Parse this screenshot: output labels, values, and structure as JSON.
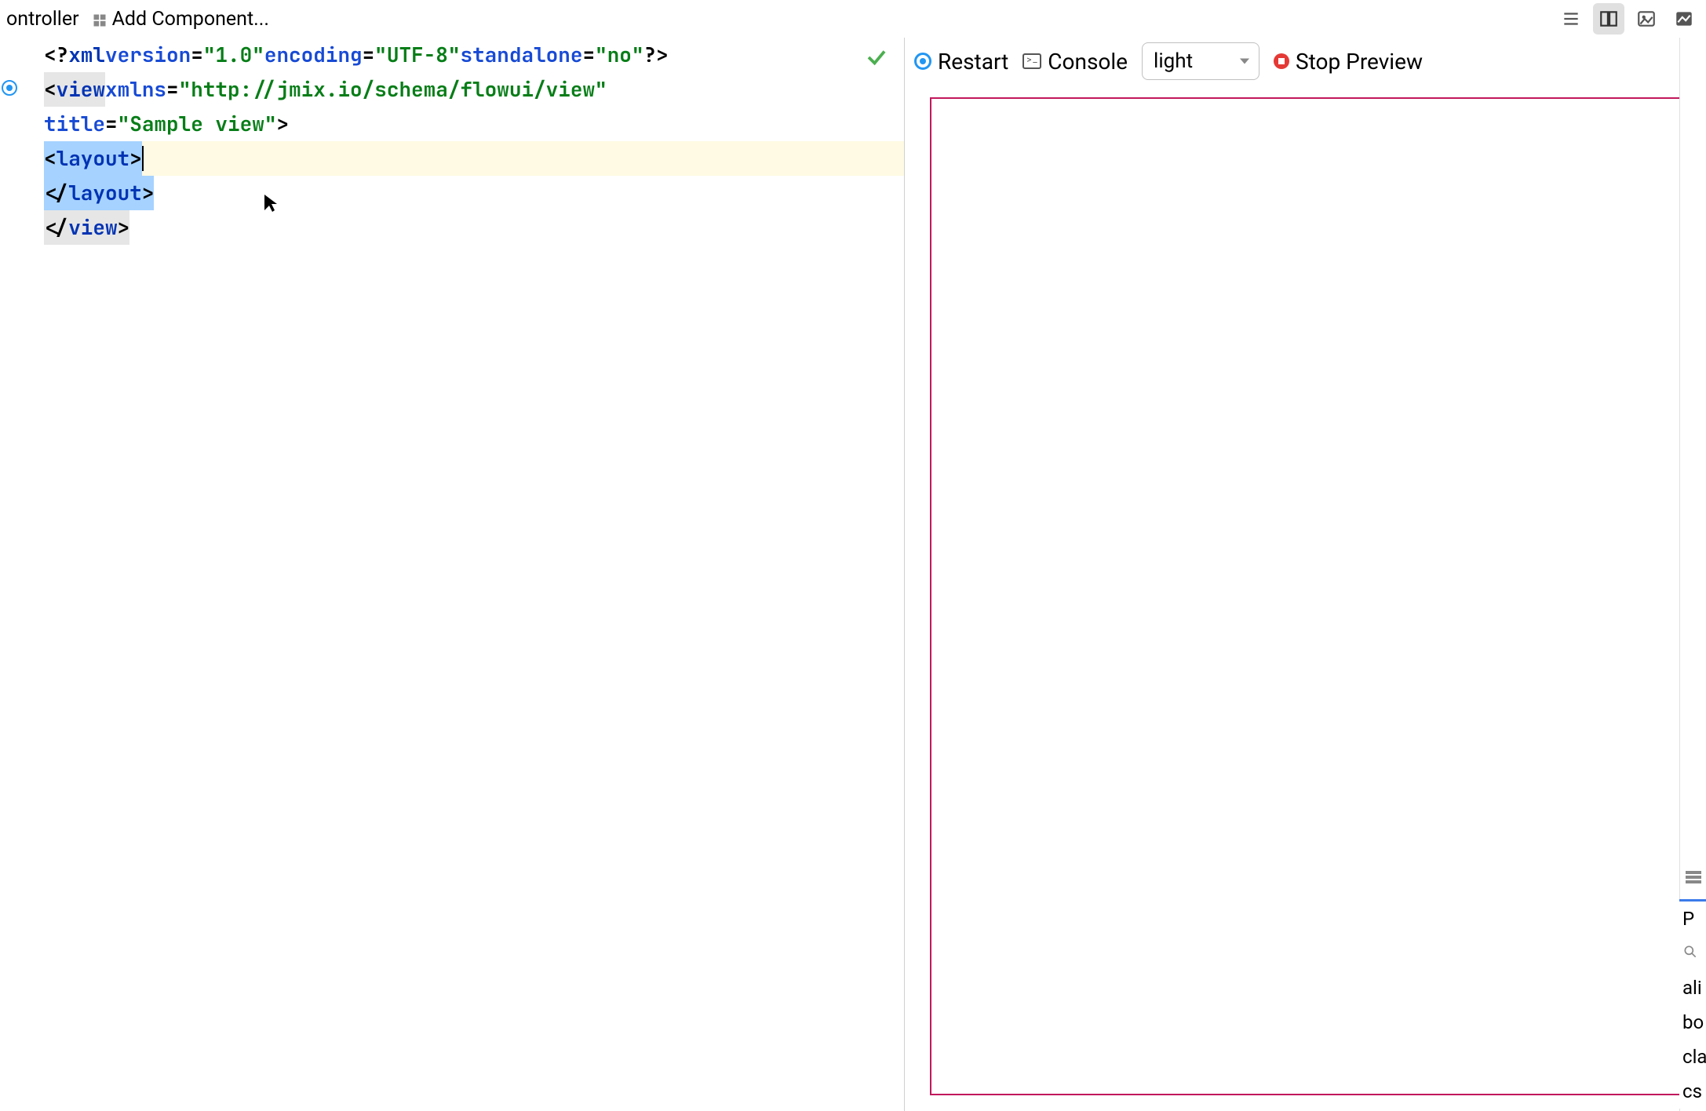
{
  "toolbar": {
    "controller_label": "ontroller",
    "add_component_label": "Add Component..."
  },
  "code": {
    "line1": {
      "xml_open": "<?",
      "xml": "xml",
      "version_attr": "version",
      "version_val": "\"1.0\"",
      "encoding_attr": "encoding",
      "encoding_val": "\"UTF-8\"",
      "standalone_attr": "standalone",
      "standalone_val": "\"no\"",
      "xml_close": "?>"
    },
    "line2": {
      "open": "<",
      "tag": "view",
      "xmlns_attr": "xmlns",
      "xmlns_val": "\"http://jmix.io/schema/flowui/view\""
    },
    "line3": {
      "title_attr": "title",
      "title_val": "\"Sample view\"",
      "close": ">"
    },
    "line4": {
      "open": "<",
      "tag": "layout",
      "close": ">"
    },
    "line5": {
      "open": "</",
      "tag": "layout",
      "close": ">"
    },
    "line6": {
      "open": "</",
      "tag": "view",
      "close": ">"
    }
  },
  "preview": {
    "restart_label": "Restart",
    "console_label": "Console",
    "theme_value": "light",
    "stop_label": "Stop Preview"
  },
  "side_panel": {
    "tab_char": "P",
    "items": [
      "ali",
      "bo",
      "cla",
      "cs"
    ]
  }
}
